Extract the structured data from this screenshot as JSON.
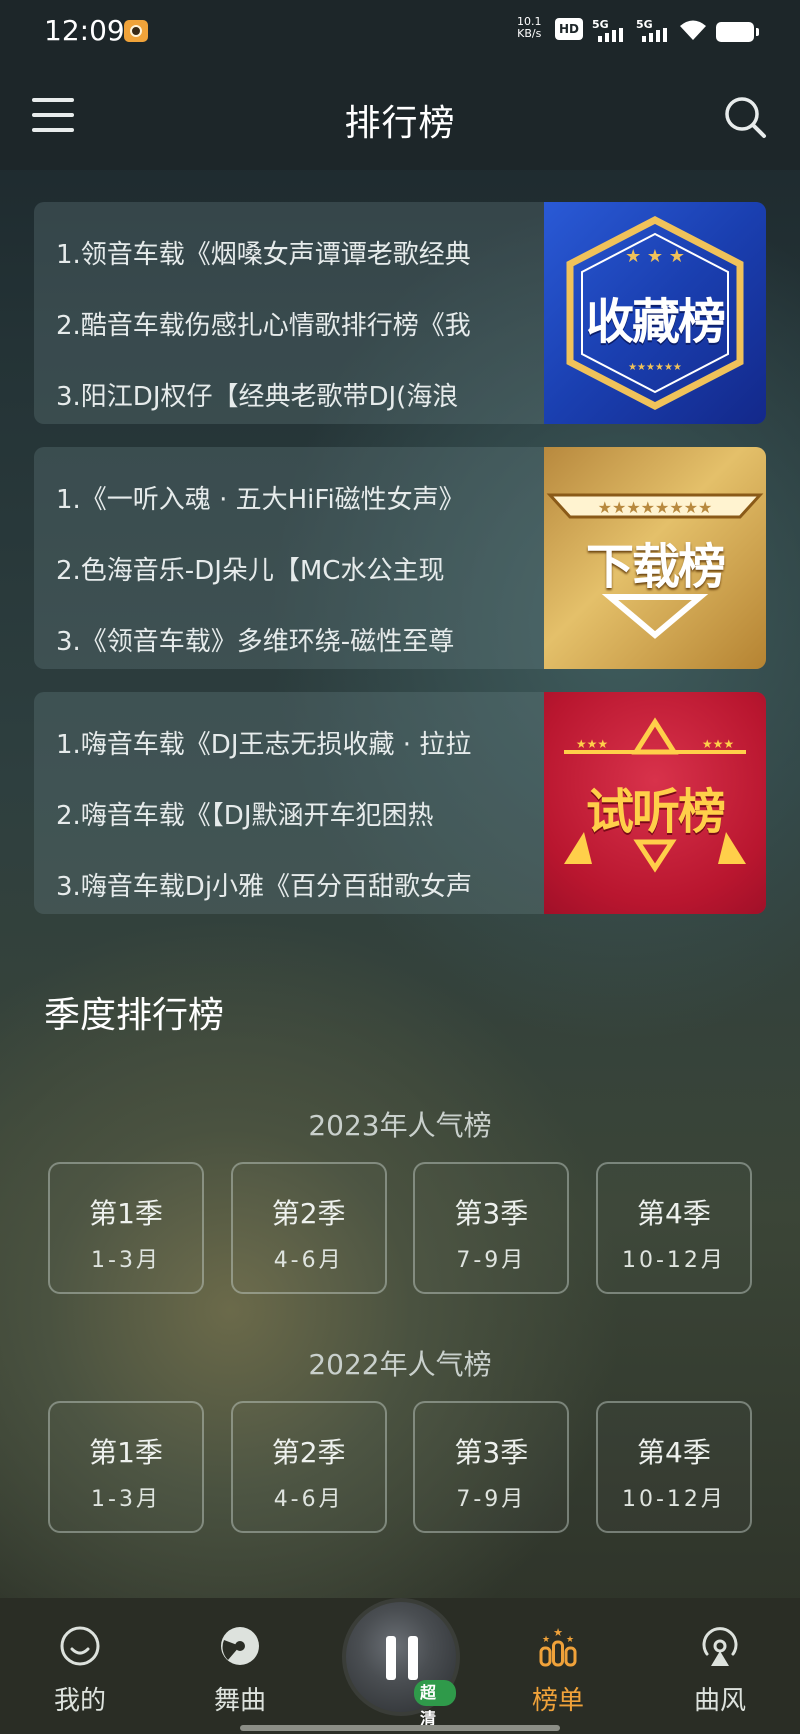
{
  "status_bar": {
    "time": "12:09",
    "net_speed_value": "10.1",
    "net_speed_unit": "KB/s",
    "hd_label": "HD",
    "sim1_label": "5G",
    "sim2_label": "5G",
    "battery_level": 1.0
  },
  "header": {
    "title": "排行榜"
  },
  "charts": [
    {
      "badge_text": "收藏榜",
      "color": "#1a3fb0",
      "lines": [
        "1.领音车载《烟嗓女声谭谭老歌经典",
        "2.酷音车载伤感扎心情歌排行榜《我",
        "3.阳江DJ权仔【经典老歌带DJ(海浪"
      ]
    },
    {
      "badge_text": "下载榜",
      "color": "#c89a48",
      "lines": [
        "1.《一听入魂 · 五大HiFi磁性女声》",
        "2.色海音乐-DJ朵儿【MC水公主现",
        "3.《领音车载》多维环绕-磁性至尊"
      ]
    },
    {
      "badge_text": "试听榜",
      "color": "#b9162f",
      "lines": [
        "1.嗨音车载《DJ王志无损收藏 · 拉拉",
        "2.嗨音车载《【DJ默涵开车犯困热",
        "3.嗨音车载Dj小雅《百分百甜歌女声"
      ]
    }
  ],
  "season_section": {
    "title": "季度排行榜",
    "years": [
      {
        "title": "2023年人气榜",
        "seasons": [
          {
            "name": "第1季",
            "range": "1-3月"
          },
          {
            "name": "第2季",
            "range": "4-6月"
          },
          {
            "name": "第3季",
            "range": "7-9月"
          },
          {
            "name": "第4季",
            "range": "10-12月"
          }
        ]
      },
      {
        "title": "2022年人气榜",
        "seasons": [
          {
            "name": "第1季",
            "range": "1-3月"
          },
          {
            "name": "第2季",
            "range": "4-6月"
          },
          {
            "name": "第3季",
            "range": "7-9月"
          },
          {
            "name": "第4季",
            "range": "10-12月"
          }
        ]
      }
    ]
  },
  "bottom_nav": {
    "items": [
      {
        "label": "我的",
        "icon": "smile-icon"
      },
      {
        "label": "舞曲",
        "icon": "disc-icon"
      },
      {
        "label": "榜单",
        "icon": "ranking-icon",
        "active": true
      },
      {
        "label": "曲风",
        "icon": "radio-icon"
      }
    ],
    "player": {
      "quality_tag": "超清",
      "state_icon": "pause-icon"
    },
    "accent_color": "#f0a23a"
  }
}
